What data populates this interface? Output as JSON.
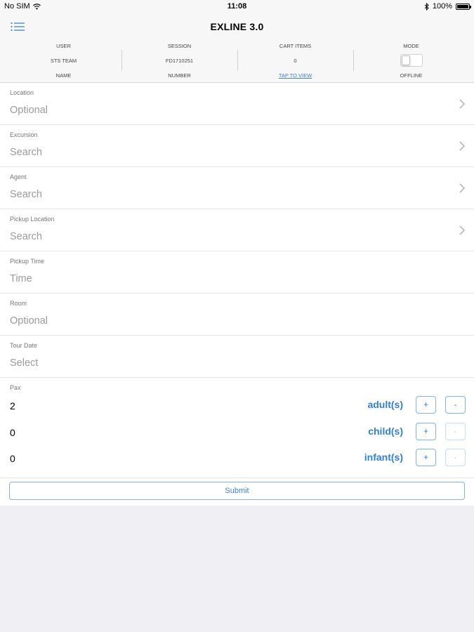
{
  "status_bar": {
    "carrier": "No SIM",
    "time": "11:08",
    "battery": "100%",
    "battery_level": 1.0
  },
  "nav": {
    "title": "EXLINE 3.0",
    "menu_icon": "list-menu-icon"
  },
  "info": {
    "user": {
      "header": "USER",
      "value": "STS TEAM",
      "footer": "NAME"
    },
    "session": {
      "header": "SESSION",
      "value": "FD1710251",
      "footer": "NUMBER"
    },
    "cart": {
      "header": "CART ITEMS",
      "value": "0",
      "footer": "TAP TO VIEW"
    },
    "mode": {
      "header": "MODE",
      "footer": "OFFLINE",
      "toggle_on": false
    }
  },
  "fields": [
    {
      "label": "Location",
      "placeholder": "Optional",
      "chevron": true
    },
    {
      "label": "Excursion",
      "placeholder": "Search",
      "chevron": true
    },
    {
      "label": "Agent",
      "placeholder": "Search",
      "chevron": true
    },
    {
      "label": "Pickup Location",
      "placeholder": "Search",
      "chevron": true
    },
    {
      "label": "Pickup Time",
      "placeholder": "Time",
      "chevron": false
    },
    {
      "label": "Room",
      "placeholder": "Optional",
      "chevron": false
    },
    {
      "label": "Tour Date",
      "placeholder": "Select",
      "chevron": false
    }
  ],
  "pax": {
    "label": "Pax",
    "rows": [
      {
        "count": "2",
        "type": "adult(s)",
        "plus": "+",
        "minus": "-",
        "minus_enabled": true
      },
      {
        "count": "0",
        "type": "child(s)",
        "plus": "+",
        "minus": "-",
        "minus_enabled": false
      },
      {
        "count": "0",
        "type": "infant(s)",
        "plus": "+",
        "minus": "-",
        "minus_enabled": false
      }
    ]
  },
  "submit_label": "Submit",
  "colors": {
    "accent": "#2f7fdc",
    "link": "#3b82d8",
    "background": "#efeff4",
    "nav_background": "#f7f7f7"
  }
}
